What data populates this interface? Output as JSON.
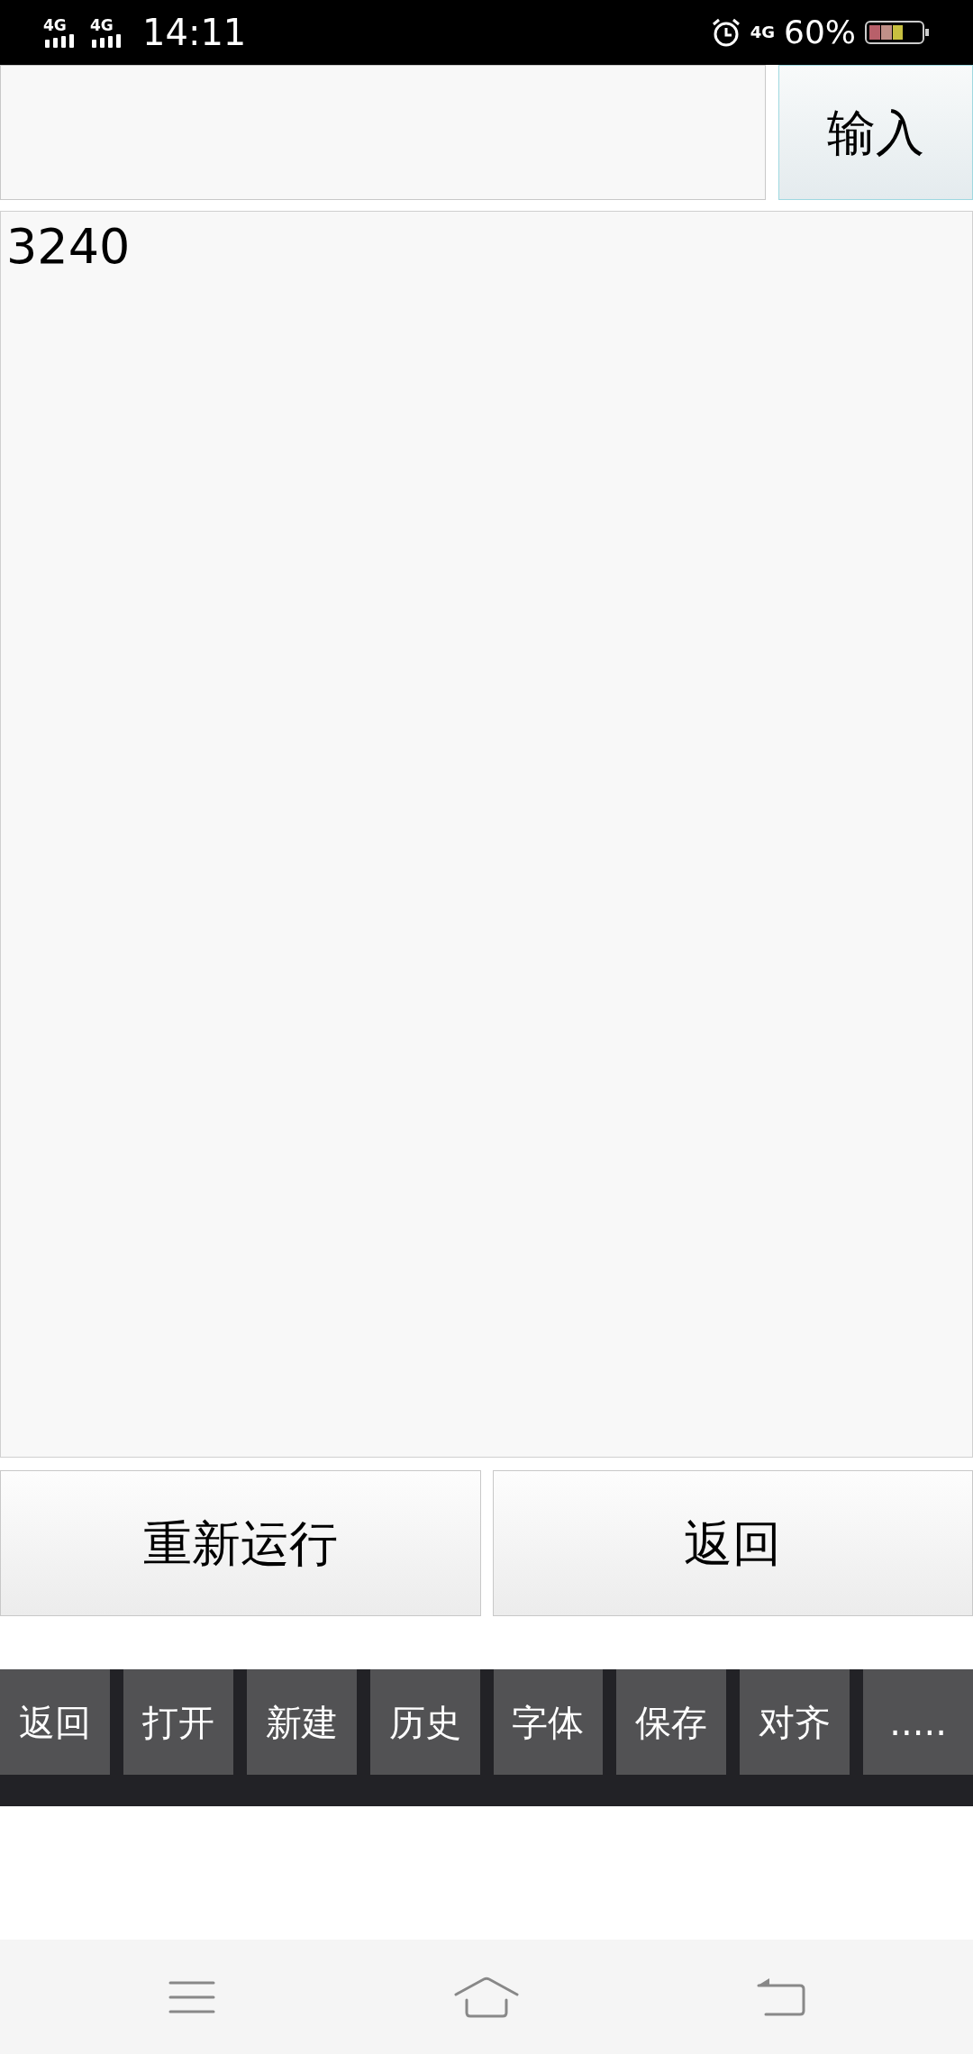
{
  "status_bar": {
    "time": "14:11",
    "signal_1": "4G",
    "signal_2": "4G",
    "network": "4G",
    "battery": "60%"
  },
  "input_button": "输入",
  "output": "3240",
  "actions": [
    "重新运行",
    "返回"
  ],
  "toolbar": [
    "返回",
    "打开",
    "新建",
    "历史",
    "字体",
    "保存",
    "对齐",
    "....."
  ]
}
